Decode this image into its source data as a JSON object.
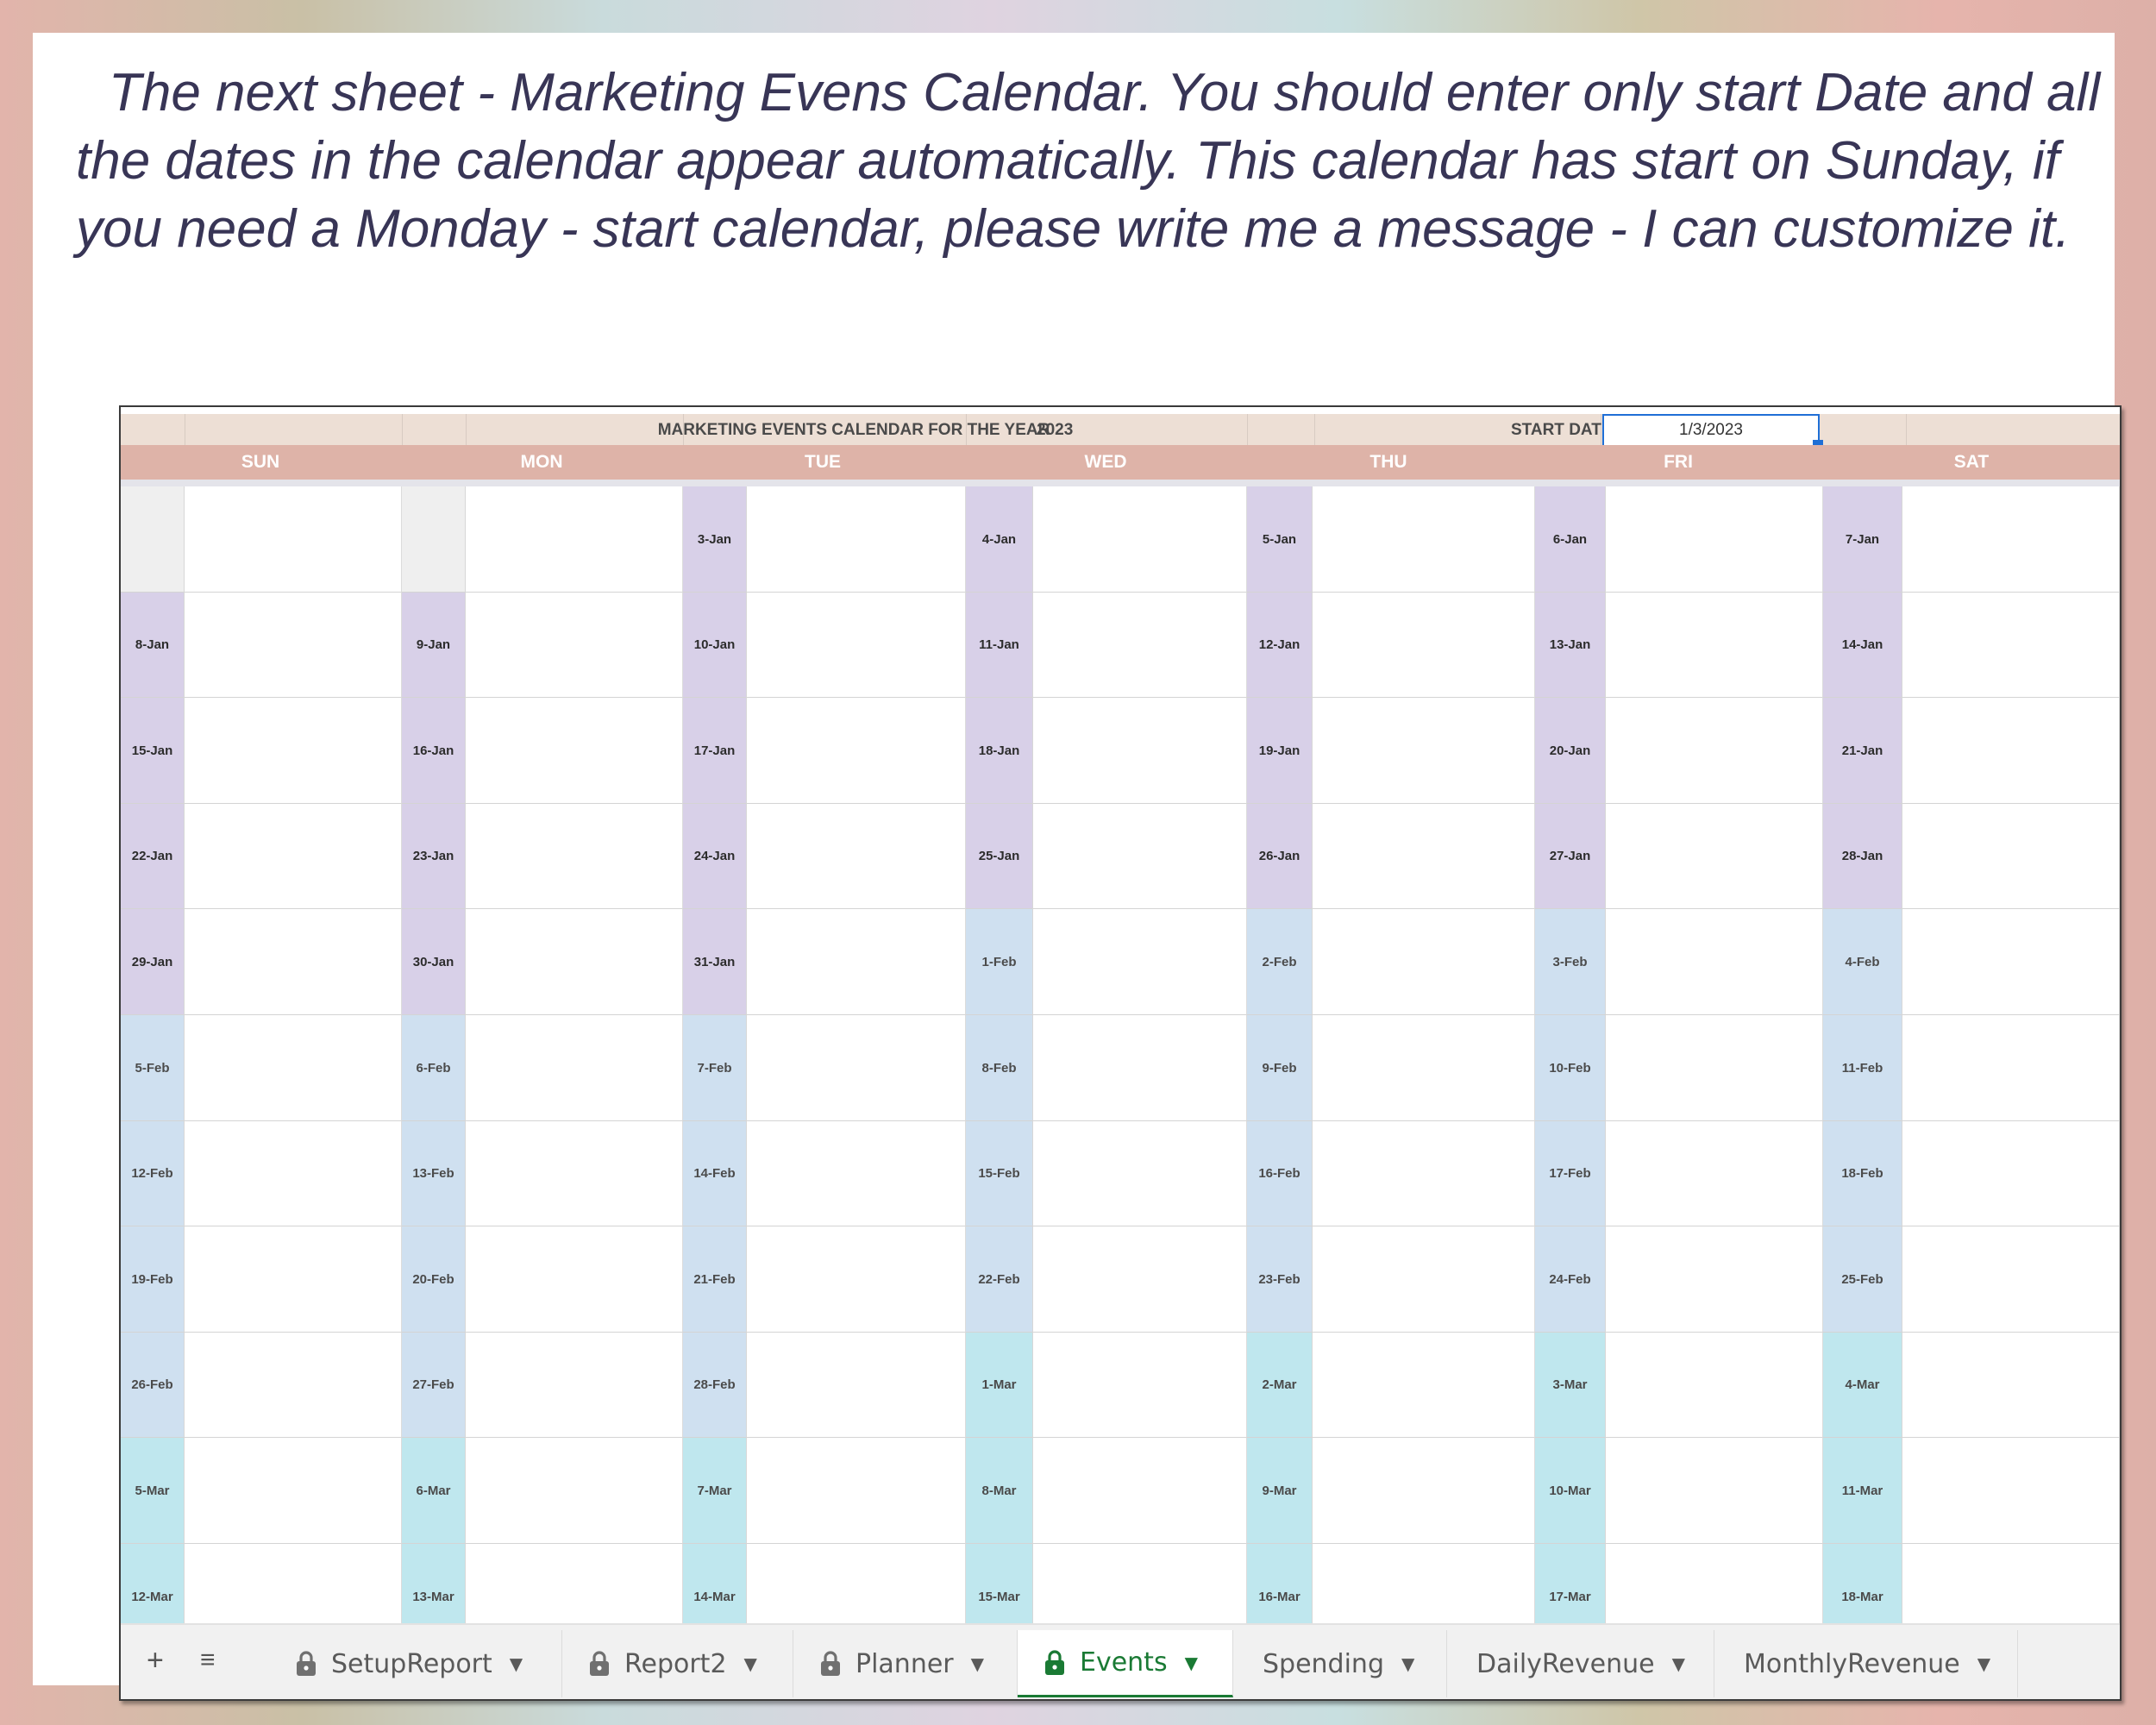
{
  "intro_text": "The next sheet - Marketing Evens Calendar. You should enter only start Date and all the dates in the calendar appear automatically. This calendar has start on Sunday, if you need a Monday - start calendar, please write me a message - I can customize it.",
  "sheet": {
    "title": "MARKETING EVENTS CALENDAR FOR THE YEAR",
    "year": "2023",
    "start_date_label": "START DATE",
    "start_date_value": "1/3/2023",
    "days": [
      "SUN",
      "MON",
      "TUE",
      "WED",
      "THU",
      "FRI",
      "SAT"
    ],
    "weeks": [
      [
        "",
        "",
        "3-Jan",
        "4-Jan",
        "5-Jan",
        "6-Jan",
        "7-Jan"
      ],
      [
        "8-Jan",
        "9-Jan",
        "10-Jan",
        "11-Jan",
        "12-Jan",
        "13-Jan",
        "14-Jan"
      ],
      [
        "15-Jan",
        "16-Jan",
        "17-Jan",
        "18-Jan",
        "19-Jan",
        "20-Jan",
        "21-Jan"
      ],
      [
        "22-Jan",
        "23-Jan",
        "24-Jan",
        "25-Jan",
        "26-Jan",
        "27-Jan",
        "28-Jan"
      ],
      [
        "29-Jan",
        "30-Jan",
        "31-Jan",
        "1-Feb",
        "2-Feb",
        "3-Feb",
        "4-Feb"
      ],
      [
        "5-Feb",
        "6-Feb",
        "7-Feb",
        "8-Feb",
        "9-Feb",
        "10-Feb",
        "11-Feb"
      ],
      [
        "12-Feb",
        "13-Feb",
        "14-Feb",
        "15-Feb",
        "16-Feb",
        "17-Feb",
        "18-Feb"
      ],
      [
        "19-Feb",
        "20-Feb",
        "21-Feb",
        "22-Feb",
        "23-Feb",
        "24-Feb",
        "25-Feb"
      ],
      [
        "26-Feb",
        "27-Feb",
        "28-Feb",
        "1-Mar",
        "2-Mar",
        "3-Mar",
        "4-Mar"
      ],
      [
        "5-Mar",
        "6-Mar",
        "7-Mar",
        "8-Mar",
        "9-Mar",
        "10-Mar",
        "11-Mar"
      ],
      [
        "12-Mar",
        "13-Mar",
        "14-Mar",
        "15-Mar",
        "16-Mar",
        "17-Mar",
        "18-Mar"
      ]
    ],
    "month_colors": {
      "Jan": "#d8d0e8",
      "Feb": "#cfe0f0",
      "Mar": "#bfe7ee"
    }
  },
  "tabs": [
    {
      "label": "SetupReport",
      "locked": true,
      "active": false,
      "icon": "lock-icon"
    },
    {
      "label": "Report2",
      "locked": true,
      "active": false,
      "icon": "lock-icon"
    },
    {
      "label": "Planner",
      "locked": true,
      "active": false,
      "icon": "lock-icon"
    },
    {
      "label": "Events",
      "locked": true,
      "active": true,
      "icon": "lock-icon"
    },
    {
      "label": "Spending",
      "locked": false,
      "active": false
    },
    {
      "label": "DailyRevenue",
      "locked": false,
      "active": false
    },
    {
      "label": "MonthlyRevenue",
      "locked": false,
      "active": false
    }
  ],
  "tabbar_controls": {
    "add_icon": "plus-icon",
    "list_icon": "all-sheets-icon"
  },
  "colors": {
    "accent_active_tab": "#1a7a34",
    "header_salmon": "#deb3a8",
    "selection_blue": "#1f6fd6"
  }
}
